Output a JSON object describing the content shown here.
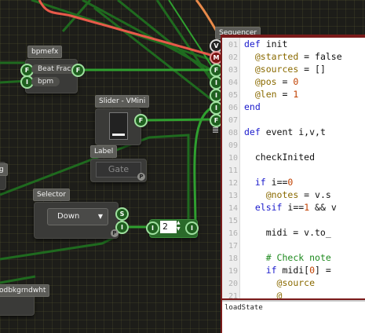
{
  "nodes": {
    "bpmefx": {
      "title": "bpmefx",
      "beat_frac": "Beat Frac",
      "bpm": "bpm"
    },
    "slider": {
      "title": "Slider - VMini"
    },
    "label": {
      "title": "Label",
      "value": "Gate"
    },
    "selector": {
      "title": "Selector",
      "value": "Down"
    },
    "number": {
      "value": "2"
    },
    "bottom": {
      "title": "odbkgrndwht"
    },
    "left_stub": {
      "title": "g"
    }
  },
  "ports": {
    "flow": "F",
    "input": "I",
    "select": "S",
    "param": "P",
    "value": "V",
    "message": "M"
  },
  "sequencer": {
    "title": "Sequencer",
    "lines": [
      {
        "n": "01",
        "segs": [
          {
            "c": "kw",
            "t": "def "
          },
          {
            "c": "",
            "t": "init"
          }
        ]
      },
      {
        "n": "02",
        "segs": [
          {
            "c": "",
            "t": "  "
          },
          {
            "c": "iv",
            "t": "@started"
          },
          {
            "c": "",
            "t": " = false"
          }
        ]
      },
      {
        "n": "03",
        "segs": [
          {
            "c": "",
            "t": "  "
          },
          {
            "c": "iv",
            "t": "@sources"
          },
          {
            "c": "",
            "t": " = []"
          }
        ]
      },
      {
        "n": "04",
        "segs": [
          {
            "c": "",
            "t": "  "
          },
          {
            "c": "iv",
            "t": "@pos"
          },
          {
            "c": "",
            "t": " = "
          },
          {
            "c": "num",
            "t": "0"
          }
        ]
      },
      {
        "n": "05",
        "segs": [
          {
            "c": "",
            "t": "  "
          },
          {
            "c": "iv",
            "t": "@len"
          },
          {
            "c": "",
            "t": " = "
          },
          {
            "c": "num",
            "t": "1"
          }
        ]
      },
      {
        "n": "06",
        "segs": [
          {
            "c": "kw",
            "t": "end"
          }
        ]
      },
      {
        "n": "07",
        "segs": []
      },
      {
        "n": "08",
        "segs": [
          {
            "c": "kw",
            "t": "def "
          },
          {
            "c": "",
            "t": "event i,v,t"
          }
        ]
      },
      {
        "n": "09",
        "segs": []
      },
      {
        "n": "10",
        "segs": [
          {
            "c": "",
            "t": "  checkInited"
          }
        ]
      },
      {
        "n": "11",
        "segs": []
      },
      {
        "n": "12",
        "segs": [
          {
            "c": "",
            "t": "  "
          },
          {
            "c": "kw",
            "t": "if "
          },
          {
            "c": "",
            "t": "i=="
          },
          {
            "c": "num",
            "t": "0"
          }
        ]
      },
      {
        "n": "13",
        "segs": [
          {
            "c": "",
            "t": "    "
          },
          {
            "c": "iv",
            "t": "@notes"
          },
          {
            "c": "",
            "t": " = v.s"
          }
        ]
      },
      {
        "n": "14",
        "segs": [
          {
            "c": "",
            "t": "  "
          },
          {
            "c": "kw",
            "t": "elsif "
          },
          {
            "c": "",
            "t": "i=="
          },
          {
            "c": "num",
            "t": "1"
          },
          {
            "c": "",
            "t": " && v"
          }
        ]
      },
      {
        "n": "15",
        "segs": []
      },
      {
        "n": "16",
        "segs": [
          {
            "c": "",
            "t": "    midi = v.to_"
          }
        ]
      },
      {
        "n": "17",
        "segs": []
      },
      {
        "n": "18",
        "segs": [
          {
            "c": "",
            "t": "    "
          },
          {
            "c": "cm",
            "t": "# Check note"
          }
        ]
      },
      {
        "n": "19",
        "segs": [
          {
            "c": "",
            "t": "    "
          },
          {
            "c": "kw",
            "t": "if "
          },
          {
            "c": "",
            "t": "midi["
          },
          {
            "c": "num",
            "t": "0"
          },
          {
            "c": "",
            "t": "] ="
          }
        ]
      },
      {
        "n": "20",
        "segs": [
          {
            "c": "",
            "t": "      "
          },
          {
            "c": "iv",
            "t": "@source"
          }
        ]
      },
      {
        "n": "21",
        "segs": [
          {
            "c": "",
            "t": "      "
          },
          {
            "c": "iv",
            "t": "@"
          }
        ]
      }
    ],
    "state_label": "loadState"
  }
}
